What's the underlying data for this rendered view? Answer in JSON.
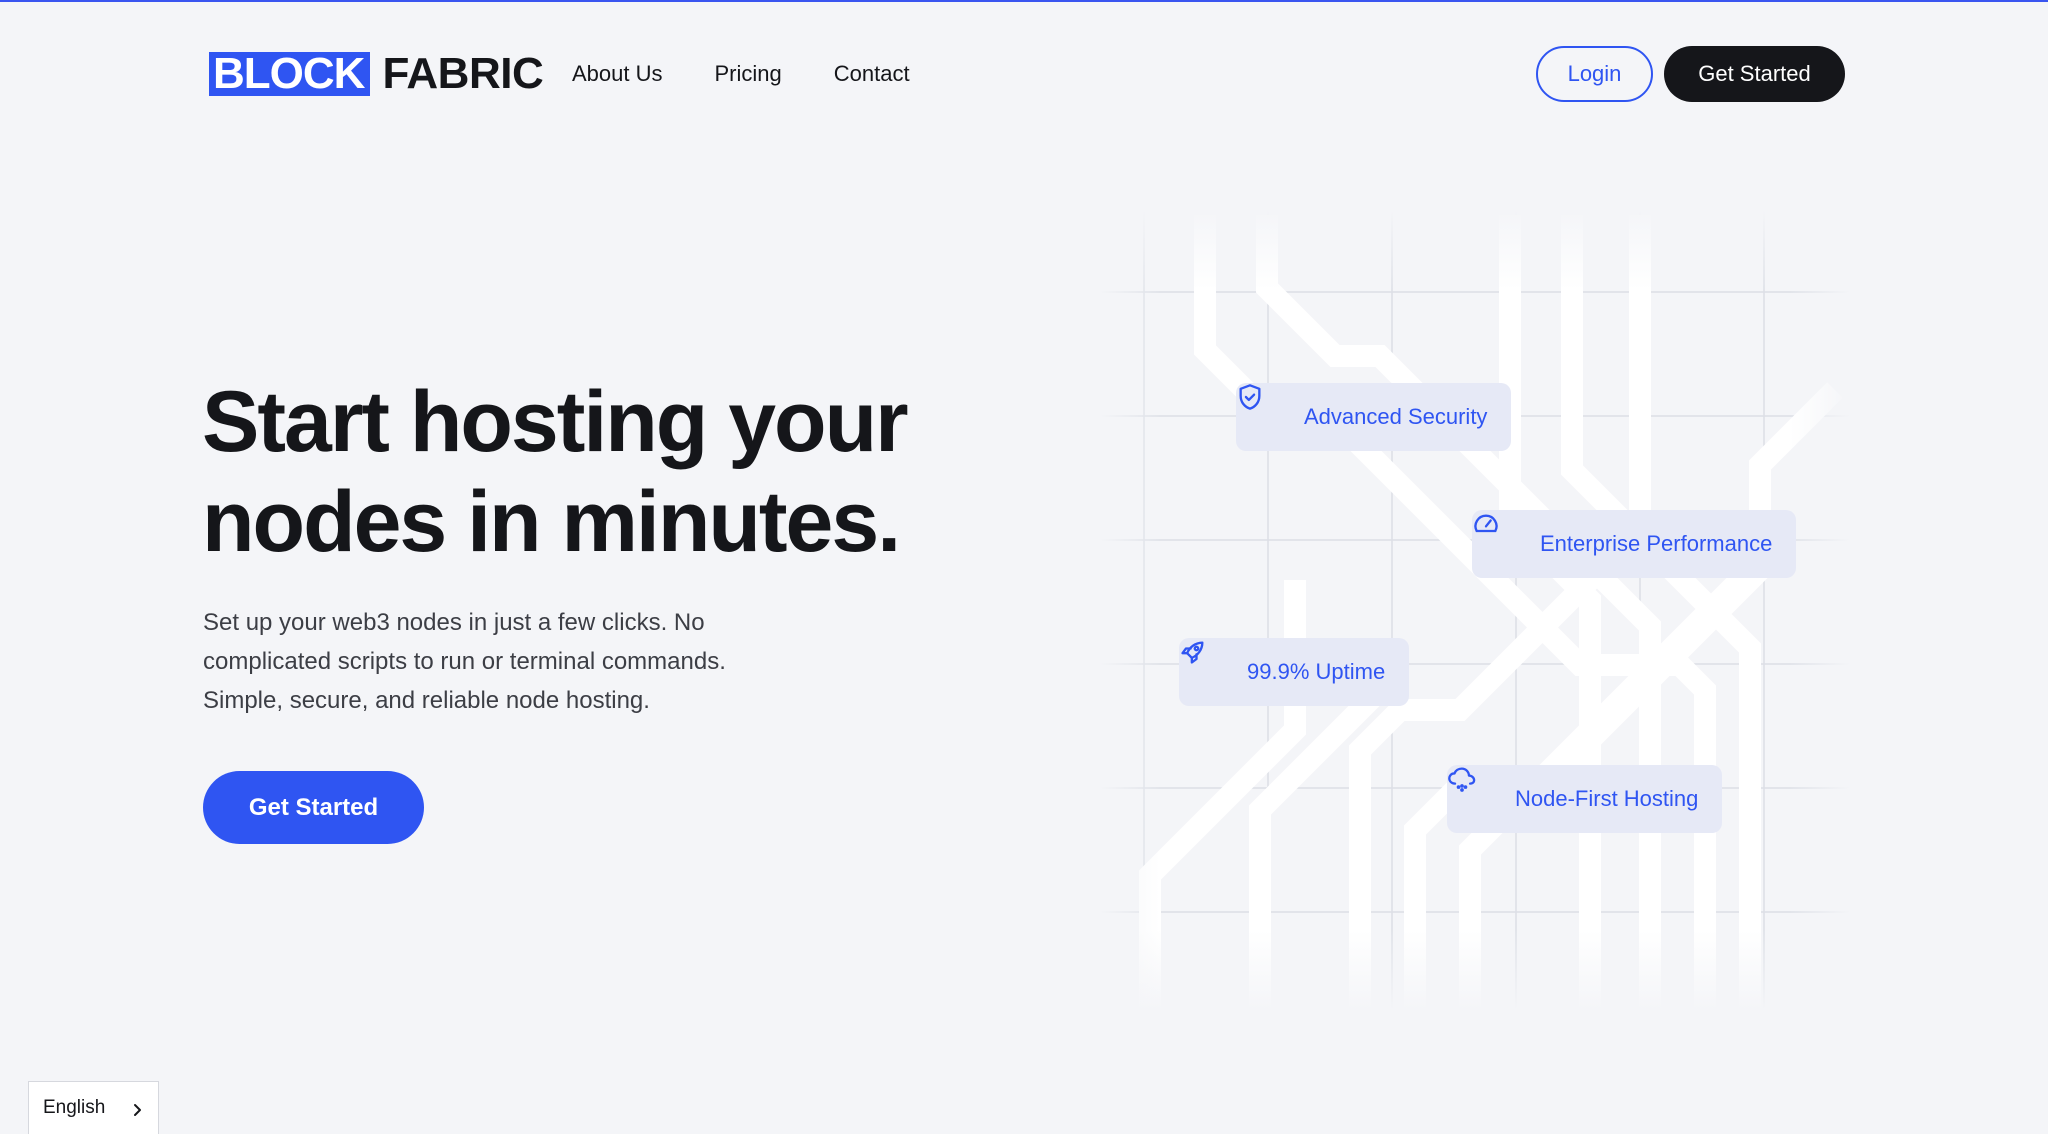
{
  "brand": {
    "logo_part1": "BLOCK",
    "logo_part2": "FABRIC",
    "accent_color": "#2f55f2",
    "dark_color": "#15161a"
  },
  "nav": {
    "links": [
      {
        "label": "About Us"
      },
      {
        "label": "Pricing"
      },
      {
        "label": "Contact"
      }
    ],
    "login_label": "Login",
    "get_started_label": "Get Started"
  },
  "hero": {
    "title_line1": "Start hosting your",
    "title_line2": "nodes in minutes.",
    "desc_line1": "Set up your web3 nodes in just a few clicks. No",
    "desc_line2": "complicated scripts to run or terminal commands.",
    "desc_line3": "Simple, secure, and reliable node hosting.",
    "cta_label": "Get Started"
  },
  "features": [
    {
      "label": "Advanced Security",
      "icon": "shield-check-icon"
    },
    {
      "label": "Enterprise Performance",
      "icon": "speedometer-icon"
    },
    {
      "label": "99.9% Uptime",
      "icon": "rocket-icon"
    },
    {
      "label": "Node-First Hosting",
      "icon": "cloud-icon"
    }
  ],
  "language": {
    "selected": "English",
    "icon": "chevron-right-icon"
  }
}
